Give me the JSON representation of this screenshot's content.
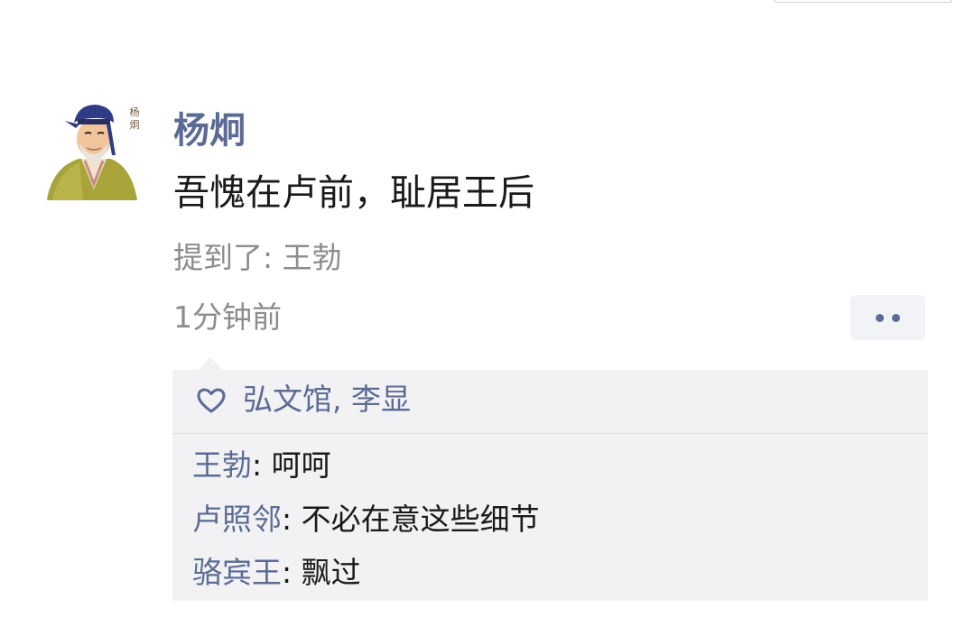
{
  "post": {
    "author": "杨炯",
    "avatar_caption": "杨\n炯",
    "content": "吾愧在卢前，耻居王后",
    "mention": "提到了: 王勃",
    "time": "1分钟前"
  },
  "likes": {
    "names": "弘文馆, 李显"
  },
  "comments": [
    {
      "author": "王勃",
      "sep": ": ",
      "text": "呵呵"
    },
    {
      "author": "卢照邻",
      "sep": ": ",
      "text": "不必在意这些细节"
    },
    {
      "author": "骆宾王",
      "sep": ": ",
      "text": "飘过"
    }
  ],
  "colors": {
    "link": "#5b6b93",
    "panel_bg": "#f2f2f4",
    "meta_text": "#8c8c8c"
  },
  "icons": {
    "more": "more-dots-icon",
    "like": "heart-icon"
  }
}
